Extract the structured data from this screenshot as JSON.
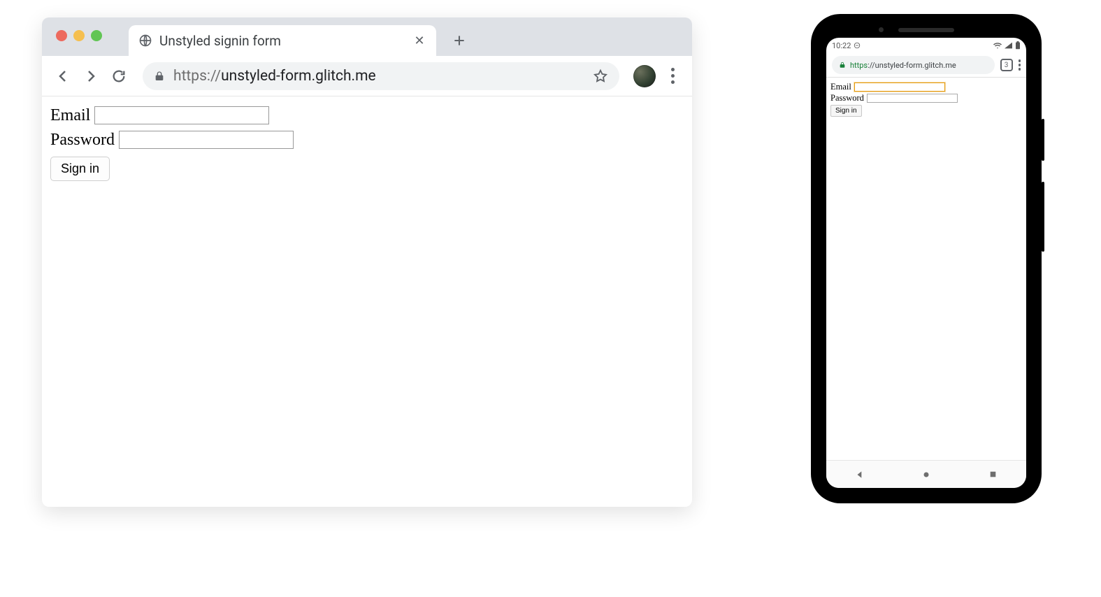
{
  "desktop": {
    "tab_title": "Unstyled signin form",
    "url_protocol": "https://",
    "url_host": "unstyled-form.glitch.me",
    "form": {
      "email_label": "Email",
      "password_label": "Password",
      "signin_label": "Sign in"
    }
  },
  "mobile": {
    "status_time": "10:22",
    "tab_count": "3",
    "url_protocol": "https",
    "url_rest": "://unstyled-form.glitch.me",
    "form": {
      "email_label": "Email",
      "password_label": "Password",
      "signin_label": "Sign in"
    }
  }
}
